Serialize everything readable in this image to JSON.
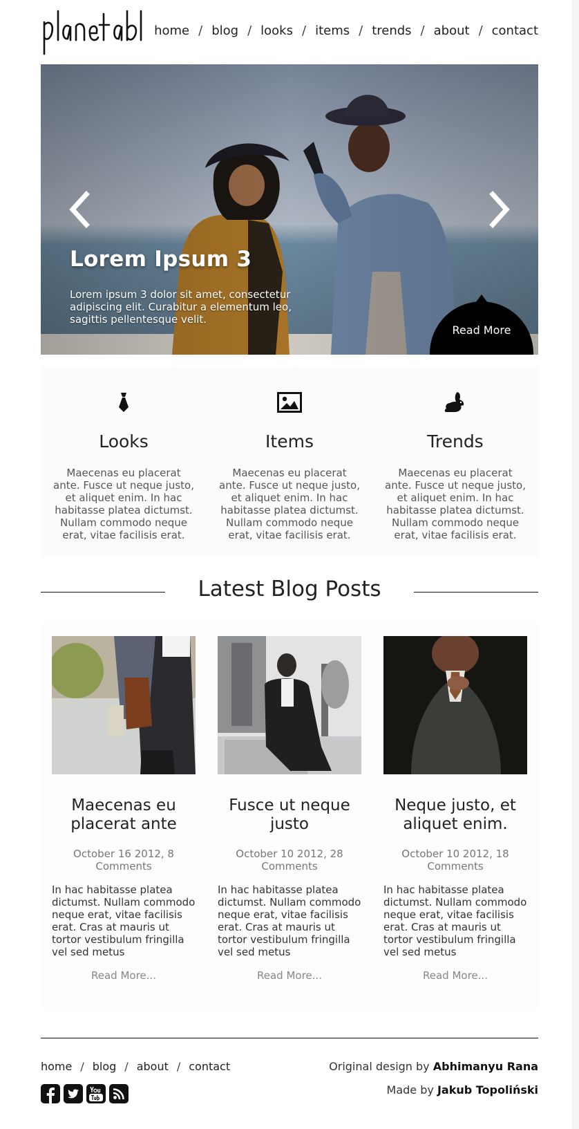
{
  "header": {
    "logo_text": "planetabhi",
    "nav": [
      "home",
      "blog",
      "looks",
      "items",
      "trends",
      "about",
      "contact"
    ],
    "separator": "/"
  },
  "hero": {
    "title": "Lorem Ipsum 3",
    "text": "Lorem ipsum 3 dolor sit amet, consectetur adipiscing elit. Curabitur a elementum leo, sagittis pellentesque velit.",
    "cta": "Read More",
    "prev_icon": "chevron-left-icon",
    "next_icon": "chevron-right-icon"
  },
  "features": [
    {
      "icon": "tie-icon",
      "title": "Looks",
      "text": "Maecenas eu placerat ante. Fusce ut neque justo, et aliquet enim. In hac habitasse platea dictumst. Nullam commodo neque erat, vitae facilisis erat."
    },
    {
      "icon": "image-icon",
      "title": "Items",
      "text": "Maecenas eu placerat ante. Fusce ut neque justo, et aliquet enim. In hac habitasse platea dictumst. Nullam commodo neque erat, vitae facilisis erat."
    },
    {
      "icon": "rabbit-icon",
      "title": "Trends",
      "text": "Maecenas eu placerat ante. Fusce ut neque justo, et aliquet enim. In hac habitasse platea dictumst. Nullam commodo neque erat, vitae facilisis erat."
    }
  ],
  "blog": {
    "heading": "Latest Blog Posts",
    "posts": [
      {
        "title": "Maecenas eu placerat ante",
        "meta": "October 16 2012, 8 Comments",
        "excerpt": "In hac habitasse platea dictumst. Nullam commodo neque erat, vitae facilisis erat. Cras at mauris ut tortor vestibulum fringilla vel sed metus",
        "more": "Read More..."
      },
      {
        "title": "Fusce ut neque justo",
        "meta": "October 10 2012, 28 Comments",
        "excerpt": "In hac habitasse platea dictumst. Nullam commodo neque erat, vitae facilisis erat. Cras at mauris ut tortor vestibulum fringilla vel sed metus",
        "more": "Read More..."
      },
      {
        "title": "Neque justo, et aliquet enim.",
        "meta": "October 10 2012, 18 Comments",
        "excerpt": "In hac habitasse platea dictumst. Nullam commodo neque erat, vitae facilisis erat. Cras at mauris ut tortor vestibulum fringilla vel sed metus",
        "more": "Read More..."
      }
    ]
  },
  "footer": {
    "nav": [
      "home",
      "blog",
      "about",
      "contact"
    ],
    "credit1_prefix": "Original design by",
    "credit1_name": "Abhimanyu Rana",
    "credit2_prefix": "Made by",
    "credit2_name": "Jakub Topoliński",
    "social": [
      "facebook-icon",
      "twitter-icon",
      "youtube-icon",
      "rss-icon"
    ]
  },
  "colors": {
    "text": "#222222",
    "muted": "#777777",
    "accent": "#000000"
  }
}
